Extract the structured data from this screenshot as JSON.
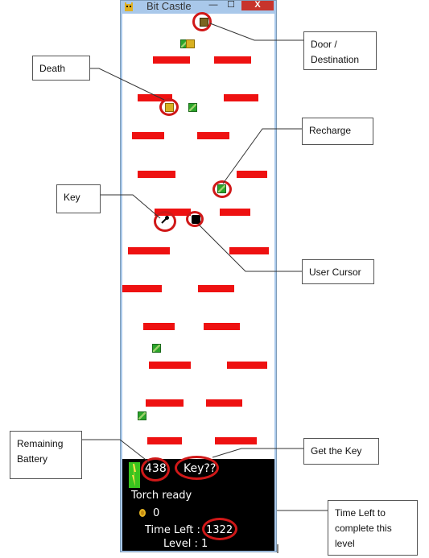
{
  "window": {
    "title": "Bit Castle",
    "close_glyph": "X",
    "min_glyph": "—",
    "max_glyph": "☐"
  },
  "hud": {
    "battery": "438",
    "key_status": "Key??",
    "torch": "Torch ready",
    "coins": "0",
    "time_label": "Time Left :",
    "time_value": "1322",
    "level": "Level : 1"
  },
  "callouts": {
    "door": "Door / Destination",
    "death": "Death",
    "recharge": "Recharge",
    "key": "Key",
    "cursor": "User Cursor",
    "battery": "Remaining Battery",
    "getkey": "Get the Key",
    "timeleft": "Time Left to complete this level"
  },
  "colors": {
    "platform": "#ee1111",
    "hud_bg": "#000000",
    "ring": "#d01818"
  }
}
